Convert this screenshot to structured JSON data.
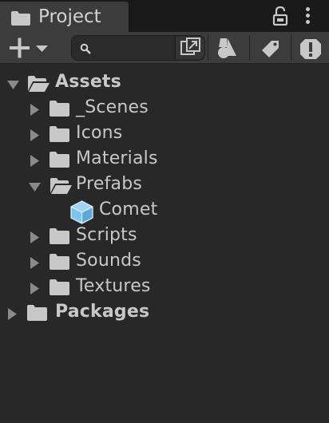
{
  "tab": {
    "title": "Project"
  },
  "search": {
    "value": "",
    "placeholder": ""
  },
  "tree": {
    "assets": "Assets",
    "scenes": "_Scenes",
    "icons": "Icons",
    "materials": "Materials",
    "prefabs": "Prefabs",
    "comet": "Comet",
    "scripts": "Scripts",
    "sounds": "Sounds",
    "textures": "Textures",
    "packages": "Packages"
  },
  "icons": {
    "tab": "folder-icon",
    "lock": "lock-icon",
    "menu": "kebab-menu-icon",
    "create": "plus-icon",
    "search": "search-icon",
    "popout": "popout-icon",
    "type_filter": "shapes-icon",
    "label_filter": "tag-icon",
    "warning": "warning-icon"
  },
  "colors": {
    "background": "#282828",
    "toolbar": "#3c3c3c",
    "tab_strip": "#191919",
    "text": "#c8c8c8",
    "prefab": "#7fc4f0"
  }
}
